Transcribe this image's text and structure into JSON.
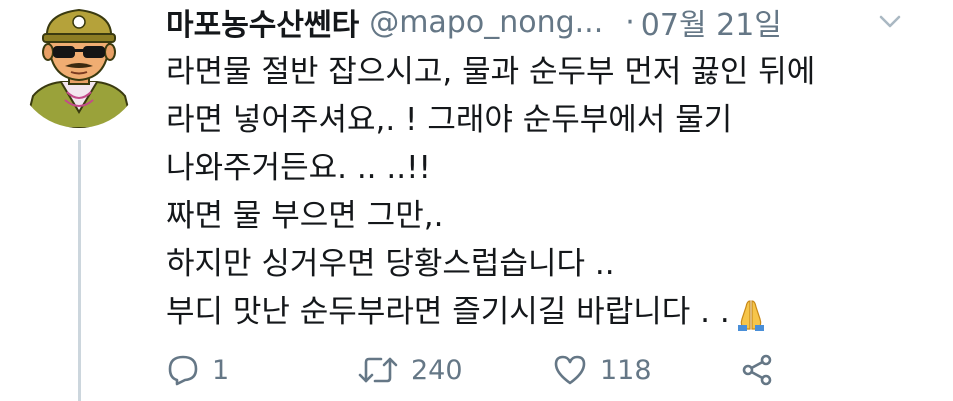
{
  "tweet": {
    "display_name": "마포농수산쎈타",
    "handle": "@mapo_nong...",
    "separator": "·",
    "date": "07월 21일",
    "lines": [
      "라면물 절반 잡으시고, 물과 순두부 먼저 끓인 뒤에",
      "라면 넣어주셔요,. ! 그래야 순두부에서 물기",
      "나와주거든요. .. ..!!",
      "짜면 물 부으면 그만,.",
      "하지만 싱거우면 당황스럽습니다 ..",
      "부디 맛난 순두부라면 즐기시길 바랍니다 . ."
    ],
    "emoji": "folded-hands-emoji"
  },
  "actions": {
    "reply_count": "1",
    "retweet_count": "240",
    "like_count": "118"
  },
  "icons": {
    "reply": "reply-icon",
    "retweet": "retweet-icon",
    "like": "heart-icon",
    "share": "share-icon",
    "menu": "chevron-down-icon"
  },
  "colors": {
    "text": "#14171a",
    "muted": "#657786",
    "thread_line": "#ccd6dd"
  }
}
